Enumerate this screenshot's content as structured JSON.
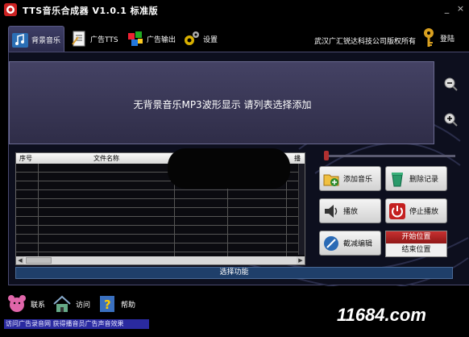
{
  "window": {
    "title": "TTS音乐合成器 V1.0.1 标准版",
    "minimize": "_",
    "close": "×"
  },
  "tabs": [
    {
      "label": "背景音乐",
      "icon": "music-note-icon",
      "active": true
    },
    {
      "label": "广告TTS",
      "icon": "document-icon",
      "active": false
    },
    {
      "label": "广告输出",
      "icon": "cubes-icon",
      "active": false
    },
    {
      "label": "设置",
      "icon": "gears-icon",
      "active": false
    }
  ],
  "header": {
    "company": "武汉广汇锐达科技公司版权所有",
    "login_label": "登陆"
  },
  "waveform": {
    "message": "无背景音乐MP3波形显示 请列表选择添加"
  },
  "table": {
    "columns": [
      "序号",
      "文件名称",
      "播"
    ],
    "rows": [],
    "hscroll_left": "◀",
    "hscroll_right": "▶"
  },
  "slider": {
    "position": 0.0
  },
  "actions": {
    "add_music": "添加音乐",
    "delete_record": "删除记录",
    "play": "播放",
    "stop_play": "停止播放",
    "clip_edit": "截减编辑",
    "start_position": "开始位置",
    "end_position": "结束位置"
  },
  "status": {
    "text": "选择功能"
  },
  "bottom": {
    "contact": "联系",
    "visit": "访问",
    "help": "帮助",
    "scroll_text": "访问广告录音网 获得播音员广告声音效果"
  },
  "watermark": {
    "text": "11684.com"
  },
  "colors": {
    "accent": "#1f3f6a",
    "waveform_bg": "#3a3856",
    "start_position_bg": "#b02020"
  }
}
